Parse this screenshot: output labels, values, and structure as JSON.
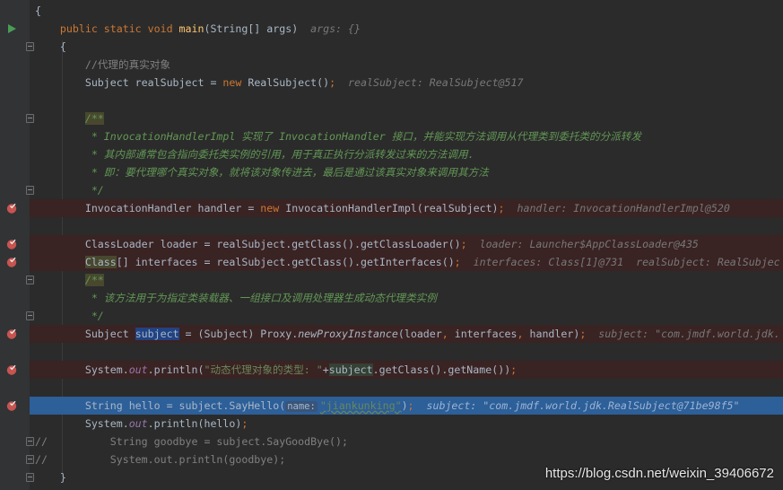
{
  "colors": {
    "background": "#2b2b2b",
    "keyword": "#cc7832",
    "text": "#a9b7c6",
    "method": "#ffc66d",
    "doc_comment": "#629755",
    "string": "#6a8759",
    "breakpoint_line": "#3a2323",
    "execution_line": "#2d5f99"
  },
  "lines": [
    {
      "gutter": "",
      "fold": false,
      "type": "",
      "tokens": [
        [
          "{",
          "txt"
        ]
      ]
    },
    {
      "gutter": "run-icon",
      "fold": false,
      "type": "",
      "tokens": [
        [
          "    public static void ",
          "kw"
        ],
        [
          "main",
          "fn"
        ],
        [
          "(String[] args)  ",
          "txt"
        ],
        [
          "args: {}",
          "hint"
        ]
      ]
    },
    {
      "gutter": "",
      "fold": true,
      "type": "",
      "tokens": [
        [
          "    {",
          "txt"
        ]
      ]
    },
    {
      "gutter": "",
      "fold": false,
      "type": "",
      "tokens": [
        [
          "        //代理的真实对象",
          "cm"
        ]
      ]
    },
    {
      "gutter": "",
      "fold": false,
      "type": "",
      "tokens": [
        [
          "        Subject realSubject = ",
          "txt"
        ],
        [
          "new",
          "kw"
        ],
        [
          " RealSubject()",
          "txt"
        ],
        [
          ";",
          "kw"
        ],
        [
          "  realSubject: RealSubject@517",
          "hint"
        ]
      ]
    },
    {
      "gutter": "",
      "fold": false,
      "type": "",
      "tokens": []
    },
    {
      "gutter": "",
      "fold": true,
      "type": "",
      "tokens": [
        [
          "        ",
          "txt"
        ],
        [
          "/**",
          "docb"
        ]
      ]
    },
    {
      "gutter": "",
      "fold": false,
      "type": "",
      "tokens": [
        [
          "         * InvocationHandlerImpl 实现了 InvocationHandler 接口，并能实现方法调用从代理类到委托类的分派转发",
          "doc"
        ]
      ]
    },
    {
      "gutter": "",
      "fold": false,
      "type": "",
      "tokens": [
        [
          "         * 其内部通常包含指向委托类实例的引用，用于真正执行分派转发过来的方法调用.",
          "doc"
        ]
      ]
    },
    {
      "gutter": "",
      "fold": false,
      "type": "",
      "tokens": [
        [
          "         * 即：要代理哪个真实对象，就将该对象传进去，最后是通过该真实对象来调用其方法",
          "doc"
        ]
      ]
    },
    {
      "gutter": "",
      "fold": true,
      "type": "",
      "tokens": [
        [
          "         */",
          "doc"
        ]
      ]
    },
    {
      "gutter": "breakpoint-icon",
      "fold": false,
      "type": "bp",
      "tokens": [
        [
          "        InvocationHandler handler = ",
          "txt"
        ],
        [
          "new",
          "kw"
        ],
        [
          " InvocationHandlerImpl(realSubject)",
          "txt"
        ],
        [
          ";",
          "kw"
        ],
        [
          "  handler: InvocationHandlerImpl@520",
          "hint"
        ]
      ]
    },
    {
      "gutter": "",
      "fold": false,
      "type": "",
      "tokens": []
    },
    {
      "gutter": "breakpoint-icon",
      "fold": false,
      "type": "bp",
      "tokens": [
        [
          "        ClassLoader loader = realSubject.getClass().getClassLoader()",
          "txt"
        ],
        [
          ";",
          "kw"
        ],
        [
          "  loader: Launcher$AppClassLoader@435",
          "hint"
        ]
      ]
    },
    {
      "gutter": "breakpoint-icon",
      "fold": false,
      "type": "bp",
      "tokens": [
        [
          "        ",
          "txt"
        ],
        [
          "Class",
          "hlo"
        ],
        [
          "[] interfaces = realSubject.getClass().getInterfaces()",
          "txt"
        ],
        [
          ";",
          "kw"
        ],
        [
          "  interfaces: Class[1]@731  realSubject: RealSubjec",
          "hint"
        ]
      ]
    },
    {
      "gutter": "",
      "fold": true,
      "type": "",
      "tokens": [
        [
          "        ",
          "txt"
        ],
        [
          "/**",
          "docb"
        ]
      ]
    },
    {
      "gutter": "",
      "fold": false,
      "type": "",
      "tokens": [
        [
          "         * 该方法用于为指定类装载器、一组接口及调用处理器生成动态代理类实例",
          "doc"
        ]
      ]
    },
    {
      "gutter": "",
      "fold": true,
      "type": "",
      "tokens": [
        [
          "         */",
          "doc"
        ]
      ]
    },
    {
      "gutter": "breakpoint-icon",
      "fold": false,
      "type": "bp",
      "tokens": [
        [
          "        Subject ",
          "txt"
        ],
        [
          "subject",
          "hl"
        ],
        [
          " = (Subject) Proxy.",
          "txt"
        ],
        [
          "newProxyInstance",
          "it"
        ],
        [
          "(loader",
          "txt"
        ],
        [
          ",",
          "kw"
        ],
        [
          " interfaces",
          "txt"
        ],
        [
          ",",
          "kw"
        ],
        [
          " handler)",
          "txt"
        ],
        [
          ";",
          "kw"
        ],
        [
          "  subject: \"com.jmdf.world.jdk.",
          "hint"
        ]
      ]
    },
    {
      "gutter": "",
      "fold": false,
      "type": "",
      "tokens": []
    },
    {
      "gutter": "breakpoint-icon",
      "fold": false,
      "type": "bp",
      "tokens": [
        [
          "        System.",
          "txt"
        ],
        [
          "out",
          "static"
        ],
        [
          ".println(",
          "txt"
        ],
        [
          "\"动态代理对象的类型: \"",
          "str"
        ],
        [
          "+",
          "txt"
        ],
        [
          "subject",
          "hlg"
        ],
        [
          ".getClass().getName())",
          "txt"
        ],
        [
          ";",
          "kw"
        ]
      ]
    },
    {
      "gutter": "",
      "fold": false,
      "type": "",
      "tokens": []
    },
    {
      "gutter": "breakpoint-icon",
      "fold": false,
      "type": "sel",
      "tokens": [
        [
          "        String hello = subject.SayHello(",
          "txt"
        ],
        [
          "name:",
          "param"
        ],
        [
          "\"jiankunking\"",
          "stru"
        ],
        [
          ")",
          "txt"
        ],
        [
          ";",
          "kw"
        ],
        [
          "  subject: \"com.jmdf.world.jdk.RealSubject@71be98f5\"",
          "hint"
        ]
      ]
    },
    {
      "gutter": "",
      "fold": false,
      "type": "",
      "tokens": [
        [
          "        System.",
          "txt"
        ],
        [
          "out",
          "static"
        ],
        [
          ".println(hello)",
          "txt"
        ],
        [
          ";",
          "kw"
        ]
      ]
    },
    {
      "gutter": "",
      "fold": true,
      "type": "",
      "tokens": [
        [
          "//          String goodbye = subject.SayGoodBye();",
          "cm"
        ]
      ]
    },
    {
      "gutter": "",
      "fold": true,
      "type": "",
      "tokens": [
        [
          "//          System.out.println(goodbye);",
          "cm"
        ]
      ]
    },
    {
      "gutter": "",
      "fold": true,
      "type": "",
      "tokens": [
        [
          "    }",
          "txt"
        ]
      ]
    }
  ],
  "watermark": "https://blog.csdn.net/weixin_39406672"
}
